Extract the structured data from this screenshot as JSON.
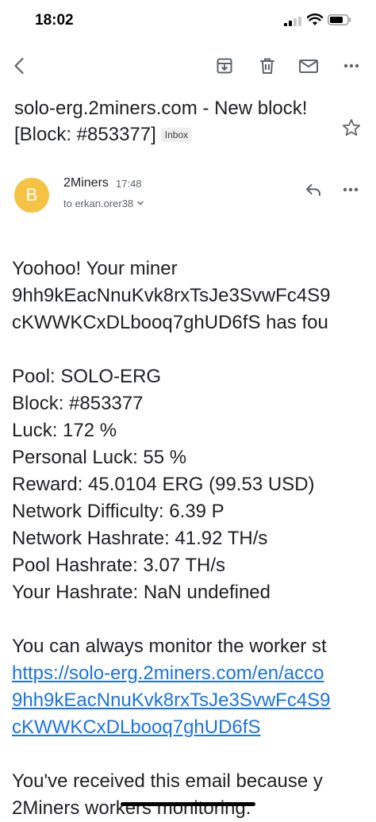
{
  "status_bar": {
    "time": "18:02"
  },
  "toolbar": {
    "back_icon": "arrow-left-icon",
    "archive_icon": "archive-icon",
    "delete_icon": "trash-icon",
    "mark_unread_icon": "envelope-icon",
    "more_icon": "more-horizontal-icon"
  },
  "email": {
    "subject_line1": "solo-erg.2miners.com - New block!",
    "subject_line2": "[Block:  #853377]",
    "label": "Inbox",
    "star_icon": "star-outline-icon",
    "sender": {
      "avatar_letter": "B",
      "avatar_color": "#f6c244",
      "name": "2Miners",
      "time": "17:48",
      "recipient": "to erkan.orer38"
    },
    "reply_icon": "reply-icon",
    "body": {
      "intro_1": "Yoohoo! Your miner",
      "intro_2": "9hh9kEacNnuKvk8rxTsJe3SvwFc4S9",
      "intro_3": "cKWWKCxDLbooq7ghUD6fS has fou",
      "stats": [
        "Pool: SOLO-ERG",
        "Block: #853377",
        "Luck: 172 %",
        "Personal Luck: 55 %",
        "Reward: 45.0104 ERG (99.53 USD)",
        "Network Difficulty: 6.39 P",
        "Network Hashrate: 41.92 TH/s",
        "Pool Hashrate: 3.07 TH/s",
        "Your Hashrate: NaN undefined"
      ],
      "monitor_text": "You can always monitor the worker st",
      "link_lines": [
        "https://solo-erg.2miners.com/en/acco",
        "9hh9kEacNnuKvk8rxTsJe3SvwFc4S9",
        "cKWWKCxDLbooq7ghUD6fS"
      ],
      "footer_1": "You've received this email because y",
      "footer_2": "2Miners workers monitoring."
    }
  },
  "colors": {
    "link": "#1a73e8",
    "text": "#202124",
    "secondary": "#5f6368"
  }
}
